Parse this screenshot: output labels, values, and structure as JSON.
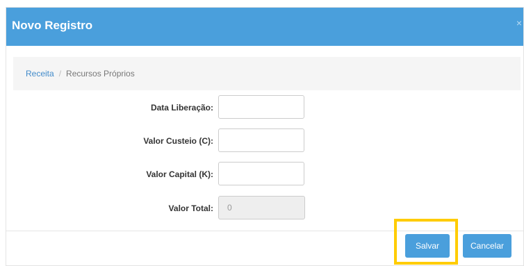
{
  "dialog": {
    "title": "Novo Registro",
    "close_glyph": "×"
  },
  "breadcrumb": {
    "root": "Receita",
    "separator": "/",
    "current": "Recursos Próprios"
  },
  "form": {
    "fields": [
      {
        "label": "Data Liberação:",
        "value": ""
      },
      {
        "label": "Valor Custeio (C):",
        "value": ""
      },
      {
        "label": "Valor Capital (K):",
        "value": ""
      },
      {
        "label": "Valor Total:",
        "value": "0"
      }
    ]
  },
  "footer": {
    "save_label": "Salvar",
    "cancel_label": "Cancelar"
  },
  "colors": {
    "header": "#4a9fdc",
    "button": "#4a9fdc",
    "highlight": "#ffcc00"
  },
  "icons": [
    "close-icon"
  ]
}
